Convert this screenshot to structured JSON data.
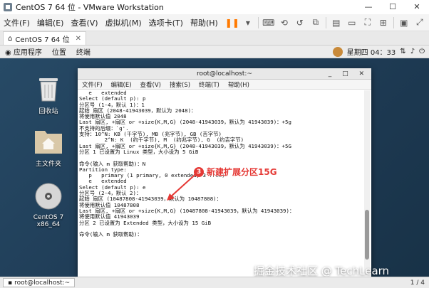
{
  "window": {
    "title": "CentOS 7 64 位 - VMware Workstation",
    "min": "—",
    "max": "☐",
    "close": "✕"
  },
  "menu": [
    "文件(F)",
    "编辑(E)",
    "查看(V)",
    "虚拟机(M)",
    "选项卡(T)",
    "帮助(H)"
  ],
  "vm_tab": {
    "label": "CentOS 7 64 位",
    "close": "✕"
  },
  "panel": {
    "apps": "应用程序",
    "places": "位置",
    "terminal": "终端",
    "clock": "星期四 04：33"
  },
  "desktop_icons": [
    {
      "label": "回收站"
    },
    {
      "label": "主文件夹"
    },
    {
      "label": "CentOS 7 x86_64"
    }
  ],
  "terminal": {
    "title": "root@localhost:~",
    "menu": [
      "文件(F)",
      "编辑(E)",
      "查看(V)",
      "搜索(S)",
      "终端(T)",
      "帮助(H)"
    ],
    "lines": [
      "   e   extended",
      "Select (default p): p",
      "分区号 (1-4，默认 1)：1",
      "起始 扇区 (2048-41943039，默认为 2048)：",
      "将使用默认值 2048",
      "Last 扇区, +扇区 or +size{K,M,G} (2048-41943039，默认为 41943039)：+5g",
      "不支持的后缀：`g'.",
      "支持：10^N: KB (千字节), MB (兆字节), GB (吉字节)",
      "        2^N: K  (约千字节), M  (约兆字节), G  (约吉字节)",
      "Last 扇区, +扇区 or +size{K,M,G} (2048-41943039，默认为 41943039)：+5G",
      "分区 1 已设置为 Linux 类型，大小设为 5 GiB",
      "",
      "命令(输入 m 获取帮助)：N",
      "Partition type:",
      "   p   primary (1 primary, 0 extended, 3 free)",
      "   e   extended",
      "Select (default p): e",
      "分区号 (2-4，默认 2)：",
      "起始 扇区 (10487808-41943039，默认为 10487808)：",
      "将使用默认值 10487808",
      "Last 扇区, +扇区 or +size{K,M,G} (10487808-41943039，默认为 41943039)：",
      "将使用默认值 41943039",
      "分区 2 已设置为 Extended 类型，大小设为 15 GiB",
      "",
      "命令(输入 m 获取帮助)："
    ]
  },
  "callout": {
    "number": "3",
    "text": "新建扩展分区15G"
  },
  "watermark": "掘金技术社区 @ TechLearn",
  "taskbar": {
    "item": "root@localhost:~",
    "pager": "1 / 4"
  },
  "colors": {
    "accent_red": "#e53935",
    "pause_orange": "#ff7a00"
  }
}
